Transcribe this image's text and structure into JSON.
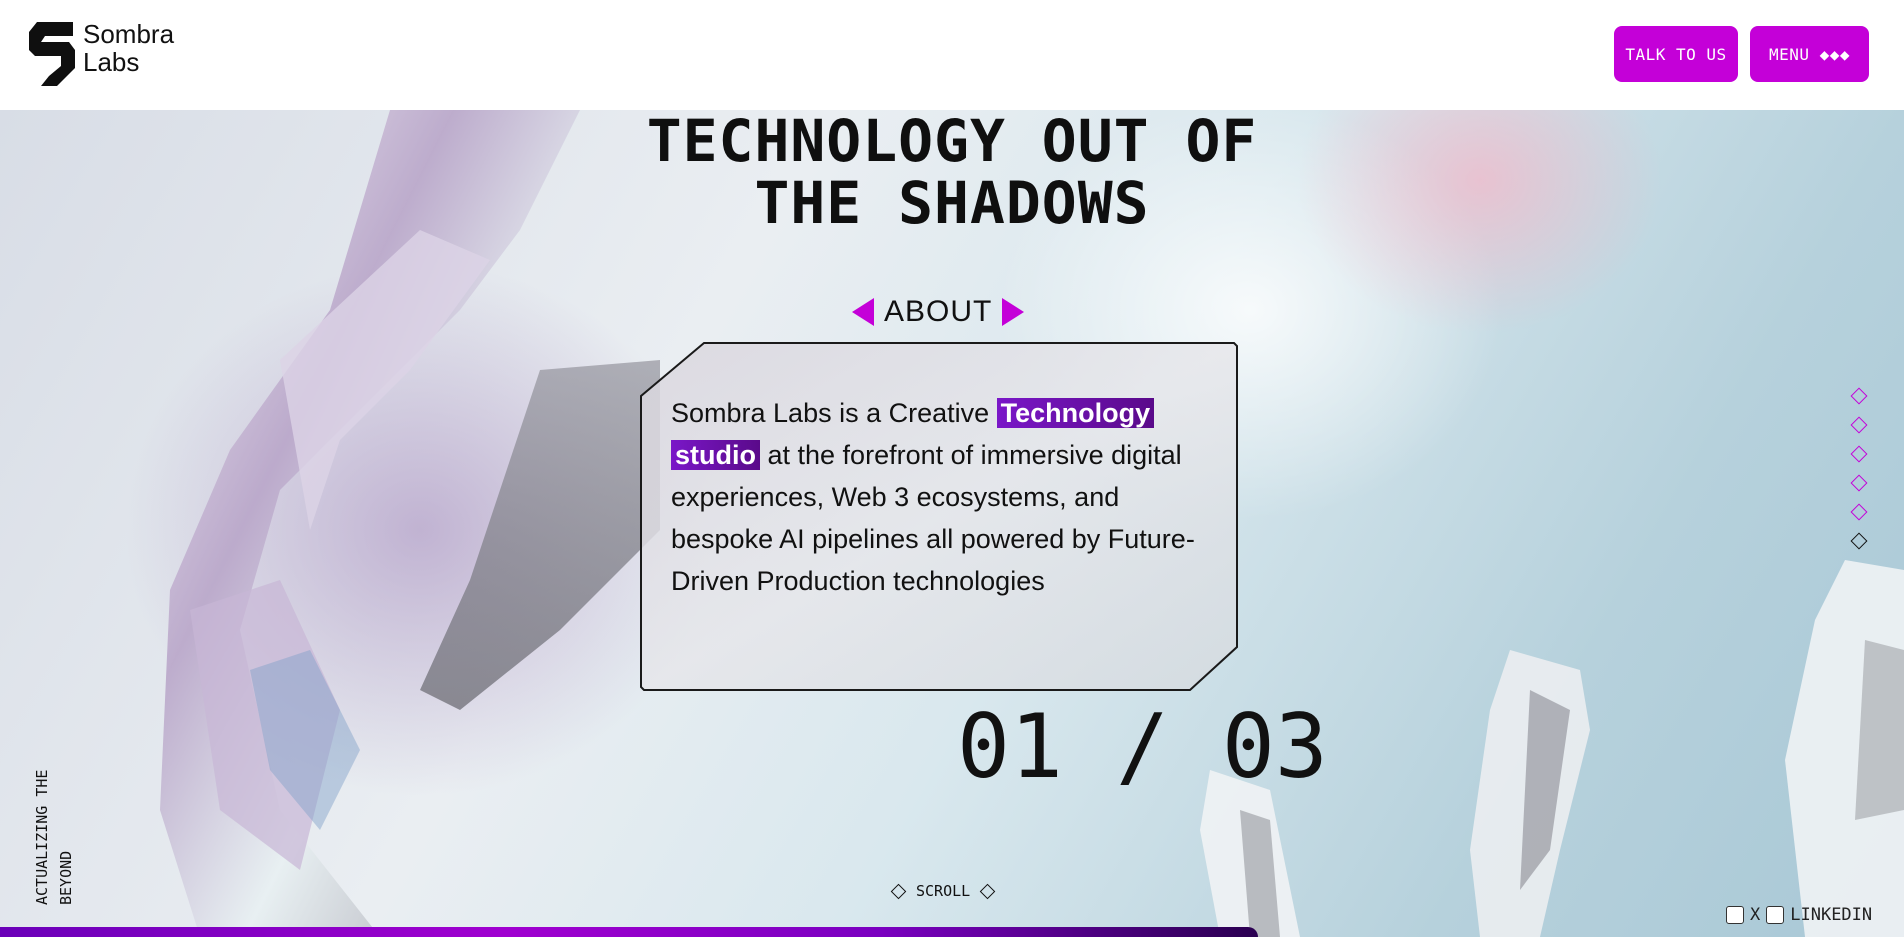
{
  "brand": {
    "name_line1": "Sombra",
    "name_line2": "Labs"
  },
  "header": {
    "talk_label": "TALK TO US",
    "menu_label": "MENU ◆◆◆"
  },
  "hero": {
    "title_line1": "TECHNOLOGY OUT OF",
    "title_line2": "THE SHADOWS",
    "section_label": "ABOUT",
    "description": {
      "part1": "Sombra Labs is a Creative ",
      "highlight1": "Technology",
      "highlight2": "studio",
      "part2": " at the forefront of immersive digital experiences, Web 3 ecosystems, and bespoke AI pipelines all powered by Future-Driven Production technologies"
    },
    "counter": "01 / 03",
    "side_line1": "ACTUALIZING THE",
    "side_line2": "BEYOND",
    "scroll_label": "SCROLL"
  },
  "section_nav": {
    "count": 6,
    "active_index": 5
  },
  "social": {
    "x_label": "X",
    "linkedin_label": "LINKEDIN"
  },
  "colors": {
    "accent": "#c400d8",
    "highlight": "#7a17c8",
    "text": "#111111"
  }
}
